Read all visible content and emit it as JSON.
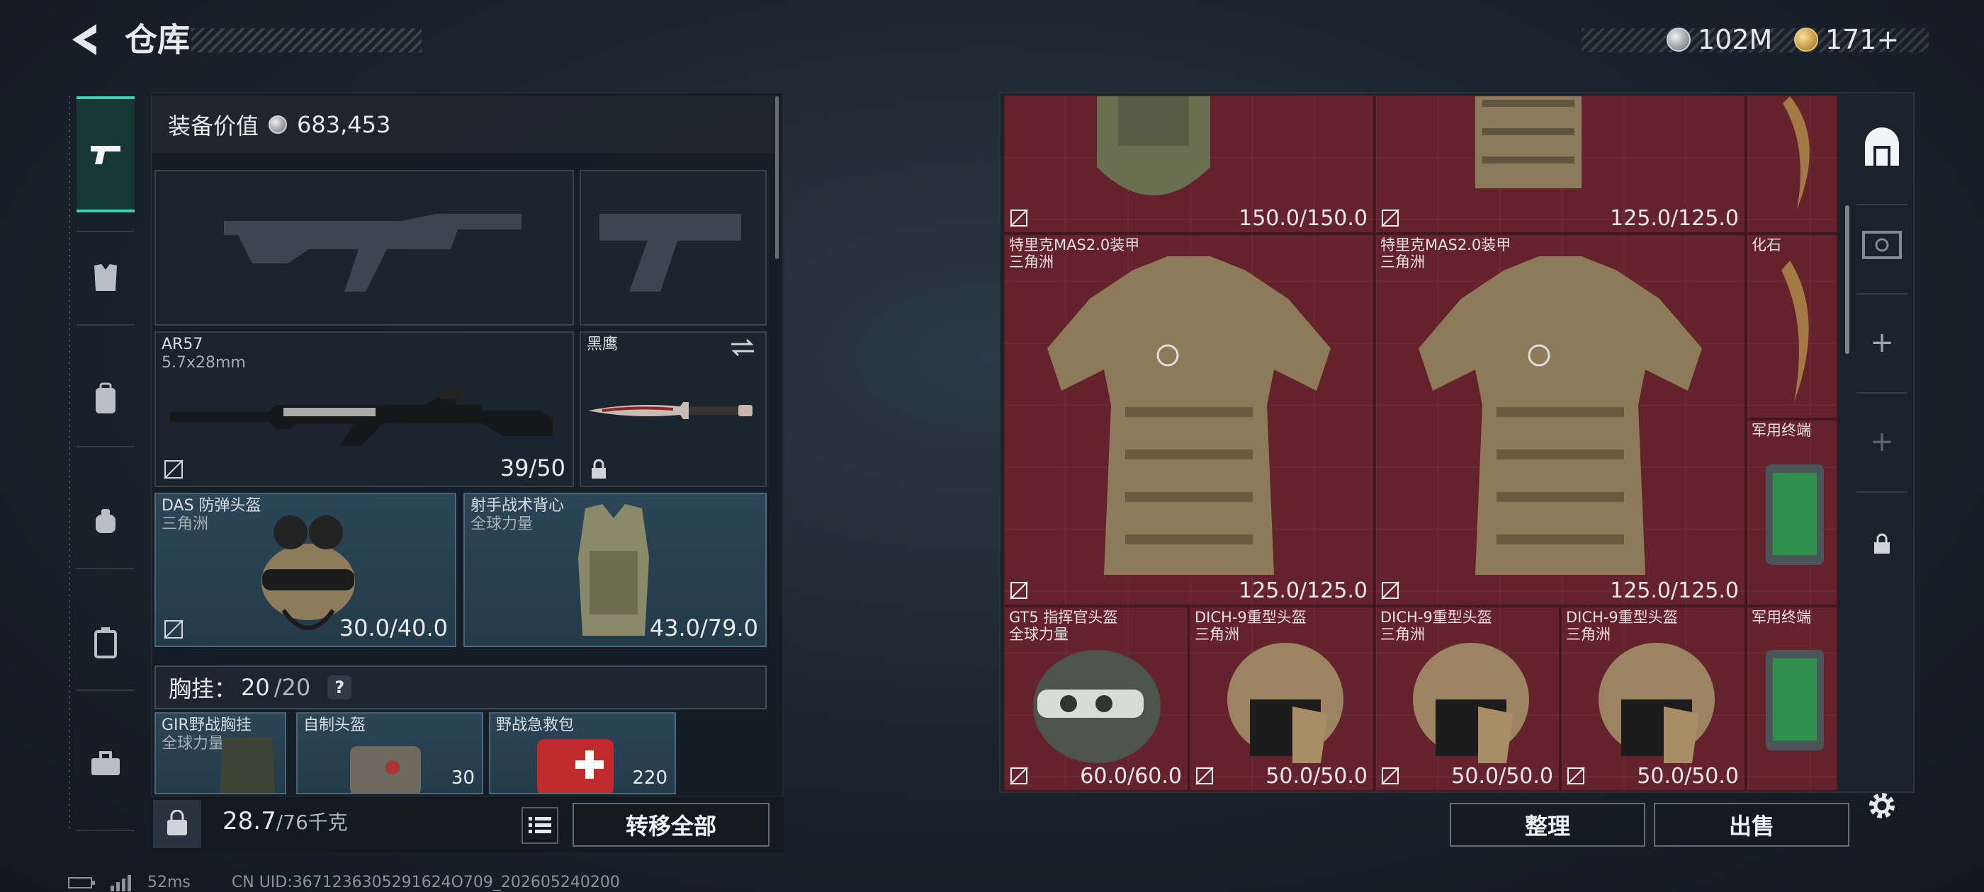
{
  "header": {
    "title": "仓库"
  },
  "currency": [
    {
      "icon": "silver-coin-icon",
      "value": "102M"
    },
    {
      "icon": "gold-coin-icon",
      "value": "171+"
    }
  ],
  "sidebar": {
    "items": [
      {
        "icon": "weapon-icon",
        "active": true
      },
      {
        "icon": "armor-icon"
      },
      {
        "icon": "backpack-icon"
      },
      {
        "icon": "bag-icon"
      },
      {
        "icon": "container-icon"
      },
      {
        "icon": "toolbox-icon"
      }
    ]
  },
  "loadout": {
    "value_label": "装备价值",
    "value": "683,453",
    "primary_weapon": {
      "name": "AR57",
      "ammo": "5.7x28mm",
      "durability": "39/50"
    },
    "melee": {
      "name": "黑鹰"
    },
    "helmet": {
      "name": "DAS 防弹头盔",
      "tag": "三角洲",
      "durability": "30.0/40.0"
    },
    "vest": {
      "name": "射手战术背心",
      "tag": "全球力量",
      "durability": "43.0/79.0"
    },
    "chest_rig": {
      "label": "胸挂：",
      "used": "20",
      "total": "/20",
      "help": "?"
    },
    "rig_items": [
      {
        "name": "GIR野战胸挂",
        "tag": "全球力量"
      },
      {
        "name": "自制头盔",
        "count": "30"
      },
      {
        "name": "野战急救包",
        "count": "220"
      }
    ]
  },
  "footer": {
    "weight": "28.7",
    "weight_max": "/76千克",
    "transfer_all": "转移全部"
  },
  "stash": {
    "items": [
      {
        "name": "",
        "tag": "",
        "durability": "150.0/150.0"
      },
      {
        "name": "",
        "tag": "",
        "durability": "125.0/125.0"
      },
      {
        "name": "特里克MAS2.0装甲",
        "tag": "三角洲",
        "durability": "125.0/125.0"
      },
      {
        "name": "特里克MAS2.0装甲",
        "tag": "三角洲",
        "durability": "125.0/125.0"
      },
      {
        "name": "化石",
        "tag": ""
      },
      {
        "name": "军用终端",
        "tag": ""
      },
      {
        "name": "GT5 指挥官头盔",
        "tag": "全球力量",
        "durability": "60.0/60.0"
      },
      {
        "name": "DICH-9重型头盔",
        "tag": "三角洲",
        "durability": "50.0/50.0"
      },
      {
        "name": "DICH-9重型头盔",
        "tag": "三角洲",
        "durability": "50.0/50.0"
      },
      {
        "name": "DICH-9重型头盔",
        "tag": "三角洲",
        "durability": "50.0/50.0"
      },
      {
        "name": "军用终端",
        "tag": ""
      }
    ],
    "sort_label": "整理",
    "sell_label": "出售"
  },
  "status": {
    "ping": "52ms",
    "uid": "CN UID:3671236305291624O709_202605240200"
  },
  "colors": {
    "accent": "#34d6b4",
    "stash_bg": "#5a1e26",
    "slot_blue": "#2c4657"
  }
}
